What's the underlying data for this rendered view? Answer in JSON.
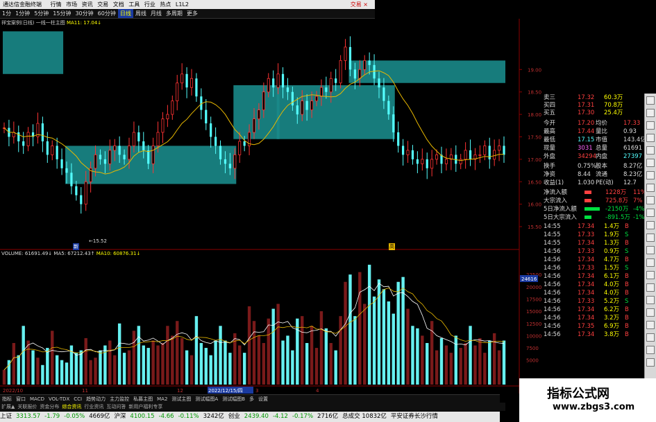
{
  "topbar": {
    "title": "通达信金融终端",
    "menu": [
      "行情",
      "市场",
      "资讯",
      "交易",
      "文档",
      "工具",
      "行业",
      "热点",
      "L1L2"
    ],
    "brand": "交易 ×"
  },
  "toolbar": {
    "items": [
      "1分",
      "1分钟",
      "5分钟",
      "15分钟",
      "30分钟",
      "60分钟",
      "日线",
      "周线",
      "月线",
      "多周期",
      "更多"
    ],
    "active": "日线"
  },
  "legend_price": {
    "name": "祥宝案例(日线)",
    "mode": "一线一柱主图",
    "ma": "MA11: 17.04↓"
  },
  "legend_volume": {
    "vol": "VOLUME: 61691.49↓",
    "ma5": "MA5: 67212.43↑",
    "ma10": "MA10: 60876.31↓"
  },
  "markers": {
    "low": "←15.52",
    "low_tag": "新",
    "high_tag": "高"
  },
  "price_axis": [
    "19.00",
    "18.50",
    "18.00",
    "17.50",
    "17.00",
    "16.50",
    "16.00",
    "15.50"
  ],
  "vol_axis": [
    "22500",
    "20000",
    "17500",
    "15000",
    "12500",
    "10000",
    "7500",
    "5000"
  ],
  "vol_axis_top": "24616",
  "date_axis": [
    "2022/10",
    "11",
    "12",
    "2022/12/15/四",
    "3",
    "4"
  ],
  "quote": {
    "book": [
      {
        "label": "卖三",
        "price": "17.32",
        "vol": "60.3万"
      },
      {
        "label": "买四",
        "price": "17.31",
        "vol": "70.8万"
      },
      {
        "label": "买五",
        "price": "17.30",
        "vol": "25.4万"
      }
    ],
    "stats": [
      {
        "l1": "今开",
        "v1": "17.20",
        "l2": "均价",
        "v2": "17.33"
      },
      {
        "l1": "最高",
        "v1": "17.44",
        "l2": "量比",
        "v2": "0.93"
      },
      {
        "l1": "最低",
        "v1": "17.15",
        "l2": "市值",
        "v2": "143.4亿"
      },
      {
        "l1": "现量",
        "v1": "3031",
        "l2": "总量",
        "v2": "61691"
      },
      {
        "l1": "外盘",
        "v1": "34294",
        "l2": "内盘",
        "v2": "27397"
      }
    ],
    "stats2": [
      {
        "l1": "换手",
        "v1": "0.75%",
        "l2": "股本",
        "v2": "8.27亿"
      },
      {
        "l1": "净资",
        "v1": "8.44",
        "l2": "流通",
        "v2": "8.23亿"
      },
      {
        "l1": "收益(1)",
        "v1": "1.030",
        "l2": "PE(动)",
        "v2": "12.7"
      }
    ],
    "flows": [
      {
        "label": "净流入额",
        "value": "1228万",
        "pct": "11%"
      },
      {
        "label": "大宗流入",
        "value": "725.8万",
        "pct": "7%"
      },
      {
        "label": "5日净流入额",
        "value": "-2150万",
        "pct": "-4%"
      },
      {
        "label": "5日大宗流入",
        "value": "-891.5万",
        "pct": "-1%"
      }
    ],
    "ticks": [
      {
        "t": "14:55",
        "p": "17.34",
        "v": "1.4万",
        "d": "B"
      },
      {
        "t": "14:55",
        "p": "17.33",
        "v": "1.9万",
        "d": "S"
      },
      {
        "t": "14:55",
        "p": "17.34",
        "v": "1.3万",
        "d": "B"
      },
      {
        "t": "14:56",
        "p": "17.33",
        "v": "0.9万",
        "d": "S"
      },
      {
        "t": "14:56",
        "p": "17.34",
        "v": "4.7万",
        "d": "B"
      },
      {
        "t": "14:56",
        "p": "17.33",
        "v": "1.5万",
        "d": "S"
      },
      {
        "t": "14:56",
        "p": "17.34",
        "v": "6.1万",
        "d": "B"
      },
      {
        "t": "14:56",
        "p": "17.34",
        "v": "4.0万",
        "d": "B"
      },
      {
        "t": "14:56",
        "p": "17.34",
        "v": "4.0万",
        "d": "B"
      },
      {
        "t": "14:56",
        "p": "17.33",
        "v": "5.2万",
        "d": "S"
      },
      {
        "t": "14:56",
        "p": "17.34",
        "v": "6.2万",
        "d": "B"
      },
      {
        "t": "14:56",
        "p": "17.34",
        "v": "3.2万",
        "d": "B"
      },
      {
        "t": "14:56",
        "p": "17.35",
        "v": "6.9万",
        "d": "B"
      },
      {
        "t": "14:56",
        "p": "17.34",
        "v": "3.8万",
        "d": "B"
      }
    ]
  },
  "indicator_tabs": [
    "指标",
    "窗口",
    "MACD",
    "VOL-TDX",
    "CCI",
    "趋势动力",
    "主力监控",
    "私募主图",
    "MA2",
    "测试主图",
    "测试幅图A",
    "测试幅图B",
    "多",
    "设置"
  ],
  "info_tabs": [
    "扩展▲",
    "关联报价",
    "资金分布",
    "综合资讯",
    "行业资讯",
    "互动问答",
    "新用户福利专享"
  ],
  "side_right": "模板",
  "indexes": [
    {
      "name": "上证",
      "value": "3313.57",
      "chg": "-1.79",
      "pct": "-0.05%",
      "amt": "4669亿"
    },
    {
      "name": "沪深",
      "value": "4100.15",
      "chg": "-4.66",
      "pct": "-0.11%",
      "amt": "3242亿"
    },
    {
      "name": "创业",
      "value": "2439.40",
      "chg": "-4.12",
      "pct": "-0.17%",
      "amt": "2716亿"
    }
  ],
  "status_tail": "总成交  10832亿",
  "broker": "平安证券长沙行情",
  "watermark": {
    "title": "指标公式网",
    "url": "www.zbgs3.com"
  },
  "colors": {
    "up": "#ff3333",
    "down": "#54ffff",
    "box": "#1a8a8a",
    "ma": "#e8b800",
    "vol_up": "#7a1a1a",
    "vol_down": "#66f0f0"
  },
  "chart_data": {
    "type": "candlestick",
    "boxes": [
      {
        "from": 0,
        "to": 12,
        "top": 19.85,
        "bottom": 18.9
      },
      {
        "from": 13,
        "to": 48,
        "top": 17.3,
        "bottom": 16.45
      },
      {
        "from": 48,
        "to": 57,
        "top": 18.65,
        "bottom": 17.45
      },
      {
        "from": 57,
        "to": 81,
        "top": 18.65,
        "bottom": 17.45
      },
      {
        "from": 72,
        "to": 104,
        "top": 19.2,
        "bottom": 18.7
      }
    ]
  }
}
